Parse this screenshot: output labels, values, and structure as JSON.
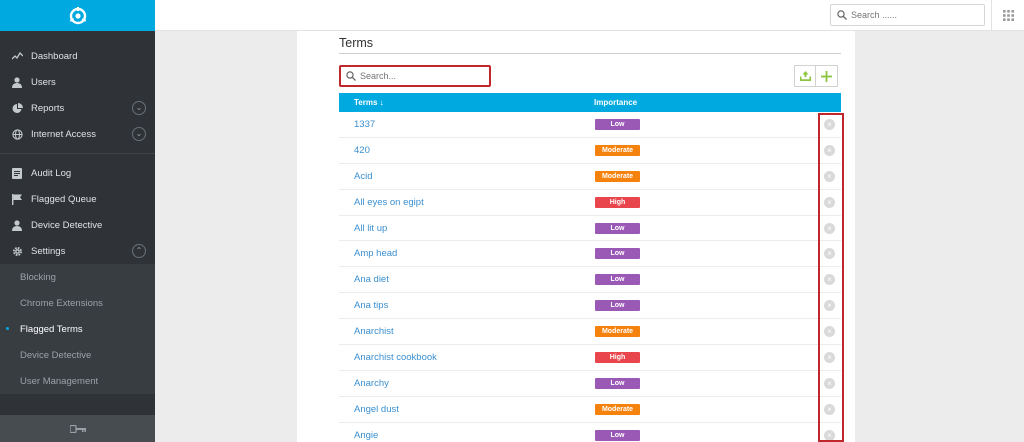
{
  "sidebar": {
    "main_items": [
      {
        "label": "Dashboard",
        "icon": "activity-icon"
      },
      {
        "label": "Users",
        "icon": "user-icon"
      },
      {
        "label": "Reports",
        "icon": "pie-chart-icon",
        "expandable": true
      },
      {
        "label": "Internet Access",
        "icon": "globe-icon",
        "expandable": true
      }
    ],
    "secondary_items": [
      {
        "label": "Audit Log",
        "icon": "log-icon"
      },
      {
        "label": "Flagged Queue",
        "icon": "flag-icon"
      },
      {
        "label": "Device Detective",
        "icon": "user-icon"
      },
      {
        "label": "Settings",
        "icon": "gear-icon",
        "expanded": true
      }
    ],
    "settings_sub": [
      {
        "label": "Blocking",
        "active": false
      },
      {
        "label": "Chrome Extensions",
        "active": false
      },
      {
        "label": "Flagged Terms",
        "active": true
      },
      {
        "label": "Device Detective",
        "active": false
      },
      {
        "label": "User Management",
        "active": false
      }
    ]
  },
  "topbar": {
    "search_placeholder": "Search ......"
  },
  "panel": {
    "title": "Terms",
    "search_placeholder": "Search...",
    "columns": {
      "term": "Terms",
      "importance": "Importance"
    },
    "rows": [
      {
        "term": "1337",
        "importance": "Low"
      },
      {
        "term": "420",
        "importance": "Moderate"
      },
      {
        "term": "Acid",
        "importance": "Moderate"
      },
      {
        "term": "All eyes on egipt",
        "importance": "High"
      },
      {
        "term": "All lit up",
        "importance": "Low"
      },
      {
        "term": "Amp head",
        "importance": "Low"
      },
      {
        "term": "Ana diet",
        "importance": "Low"
      },
      {
        "term": "Ana tips",
        "importance": "Low"
      },
      {
        "term": "Anarchist",
        "importance": "Moderate"
      },
      {
        "term": "Anarchist cookbook",
        "importance": "High"
      },
      {
        "term": "Anarchy",
        "importance": "Low"
      },
      {
        "term": "Angel dust",
        "importance": "Moderate"
      },
      {
        "term": "Angie",
        "importance": "Low"
      }
    ]
  },
  "colors": {
    "accent": "#00a9e0",
    "sidebar_bg": "#2f3337",
    "low": "#9b59b6",
    "moderate": "#f5820d",
    "high": "#e8454c",
    "highlight": "#c0272d"
  }
}
